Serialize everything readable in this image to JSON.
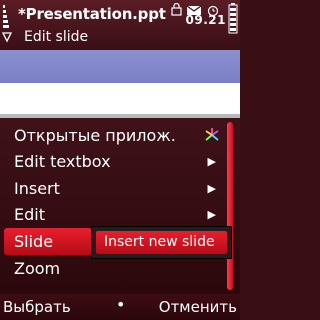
{
  "status": {
    "title": "*Presentation.ppt",
    "subtitle": "Edit slide",
    "time": "09.21"
  },
  "menu": {
    "items": [
      {
        "label": "Открытые прилож.",
        "icon": "apps-icon"
      },
      {
        "label": "Edit textbox",
        "submenu": true
      },
      {
        "label": "Insert",
        "submenu": true
      },
      {
        "label": "Edit",
        "submenu": true
      },
      {
        "label": "Slide",
        "selected": true
      },
      {
        "label": "Zoom"
      }
    ],
    "submenu": {
      "item": "Insert new slide"
    }
  },
  "softkeys": {
    "left": "Выбрать",
    "middle": "•",
    "right": "Отменить"
  },
  "colors": {
    "accent": "#e51c2b",
    "background": "#3a0f14",
    "app_bar": "#8187c9"
  }
}
